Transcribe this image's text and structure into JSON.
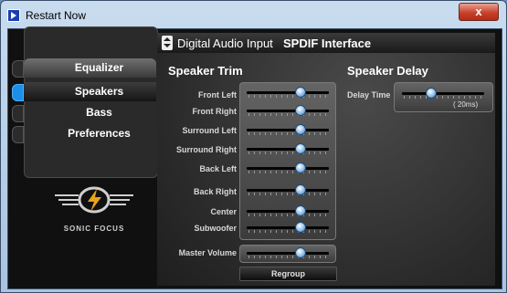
{
  "window": {
    "title": "Restart Now",
    "close_label": "x"
  },
  "nav": {
    "items": [
      {
        "label": "Equalizer",
        "active": false
      },
      {
        "label": "Speakers",
        "active": true
      },
      {
        "label": "Bass",
        "active": false
      },
      {
        "label": "Preferences",
        "active": false
      }
    ]
  },
  "brand": {
    "logo_text": "SONIC FOCUS",
    "logo_icon": "sonic-focus-logo"
  },
  "header": {
    "input_label": "Digital Audio Input",
    "interface_label": "SPDIF Interface"
  },
  "speaker_trim": {
    "title": "Speaker Trim",
    "channels": [
      {
        "label": "Front Left",
        "level": 0.65
      },
      {
        "label": "Front Right",
        "level": 0.65
      },
      {
        "label": "Surround Left",
        "level": 0.65
      },
      {
        "label": "Surround Right",
        "level": 0.65
      },
      {
        "label": "Back Left",
        "level": 0.65
      },
      {
        "label": "Back Right",
        "level": 0.65
      },
      {
        "label": "Center",
        "level": 0.65
      },
      {
        "label": "Subwoofer",
        "level": 0.65
      }
    ],
    "master": {
      "label": "Master Volume",
      "level": 0.65
    },
    "regroup_label": "Regroup"
  },
  "speaker_delay": {
    "title": "Speaker Delay",
    "label": "Delay Time",
    "value_text": "( 20ms)",
    "level": 0.35
  }
}
